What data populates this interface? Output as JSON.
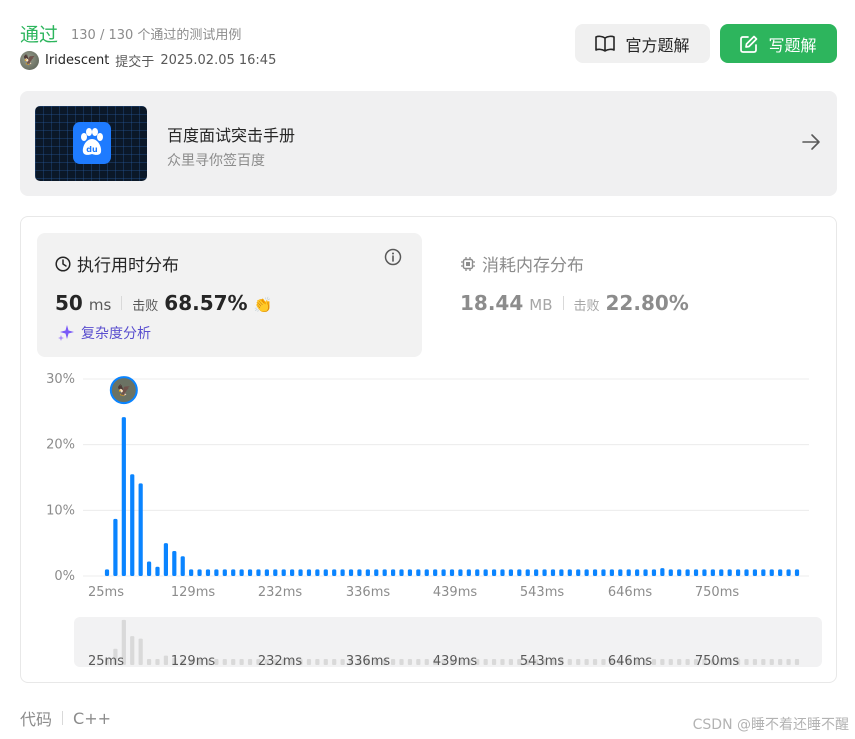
{
  "header": {
    "status": "通过",
    "cases": "130 / 130 个通过的测试用例",
    "avatar_glyph": "🦅",
    "username": "Iridescent",
    "submitted_prefix": "提交于",
    "submitted_time": "2025.02.05 16:45",
    "official_solution_label": "官方题解",
    "write_solution_label": "写题解"
  },
  "banner": {
    "title": "百度面试突击手册",
    "subtitle": "众里寻你签百度",
    "logo_text": "du"
  },
  "runtime": {
    "title": "执行用时分布",
    "value": "50",
    "unit": "ms",
    "beat_label": "击败",
    "beat_percent": "68.57%",
    "clap_glyph": "👏",
    "analysis_label": "复杂度分析"
  },
  "memory": {
    "title": "消耗内存分布",
    "value": "18.44",
    "unit": "MB",
    "beat_label": "击败",
    "beat_percent": "22.80%"
  },
  "chart_data": {
    "type": "bar",
    "y_ticks": [
      "30%",
      "20%",
      "10%",
      "0%"
    ],
    "ylim": [
      0,
      30
    ],
    "x_tick_labels": [
      "25ms",
      "129ms",
      "232ms",
      "336ms",
      "439ms",
      "543ms",
      "646ms",
      "750ms"
    ],
    "values": [
      1.0,
      8.7,
      24.2,
      15.5,
      14.1,
      2.2,
      1.4,
      5.0,
      3.8,
      3.0,
      1.0,
      1.0,
      1.0,
      1.0,
      1.0,
      1.0,
      1.0,
      1.0,
      1.0,
      1.0,
      1.0,
      1.0,
      1.0,
      1.0,
      1.0,
      1.0,
      1.0,
      1.0,
      1.0,
      1.0,
      1.0,
      1.0,
      1.0,
      1.0,
      1.0,
      1.0,
      1.0,
      1.0,
      1.0,
      1.0,
      1.0,
      1.0,
      1.0,
      1.0,
      1.0,
      1.0,
      1.0,
      1.0,
      1.0,
      1.0,
      1.0,
      1.0,
      1.0,
      1.0,
      1.0,
      1.0,
      1.0,
      1.0,
      1.0,
      1.0,
      1.0,
      1.0,
      1.0,
      1.0,
      1.0,
      1.0,
      1.2,
      1.0,
      1.0,
      1.0,
      1.0,
      1.0,
      1.0,
      1.0,
      1.0,
      1.0,
      1.0,
      1.0,
      1.0,
      1.0,
      1.0,
      1.0,
      1.0
    ],
    "highlight_bar_index": 2,
    "bar_color": "#0a84ff",
    "grid": true
  },
  "colors": {
    "accent_green": "#2db55d",
    "bar_blue": "#0a84ff",
    "analysis_purple": "#5a4fcf"
  },
  "footer": {
    "label": "代码",
    "language": "C++",
    "watermark": "CSDN @睡不着还睡不醒"
  }
}
